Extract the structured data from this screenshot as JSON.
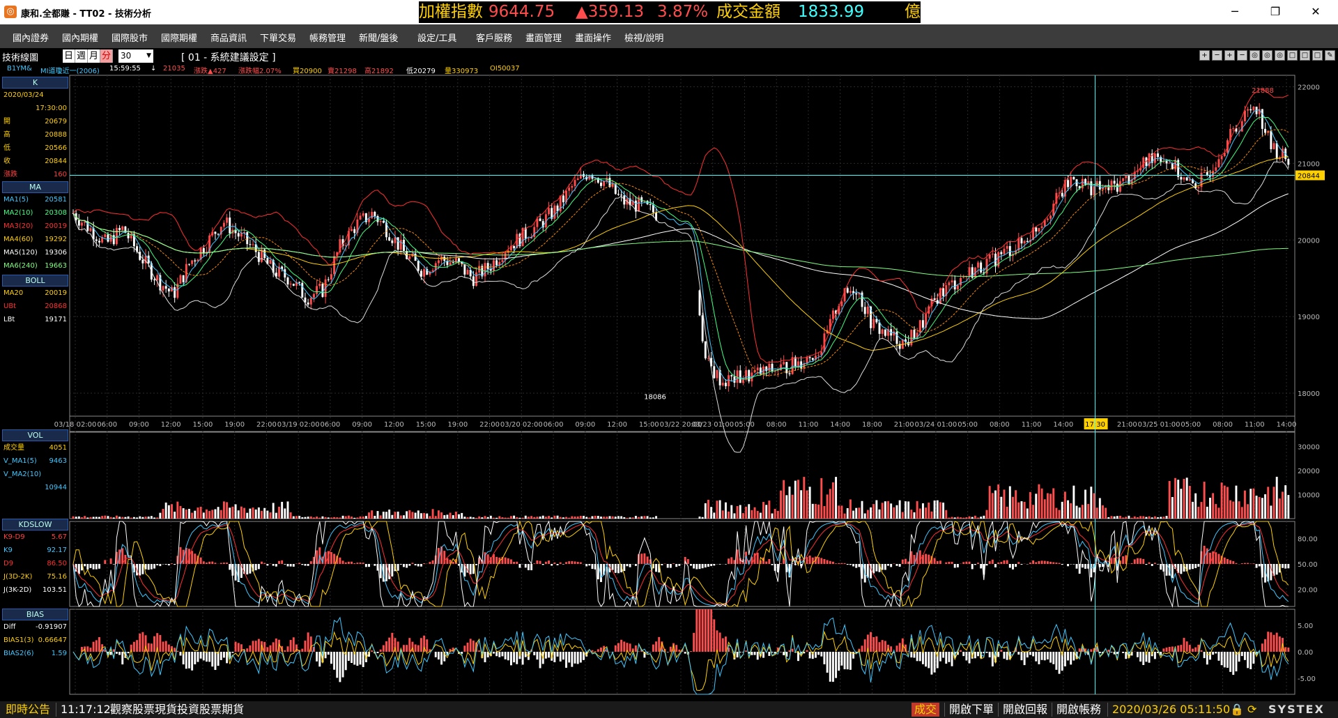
{
  "window": {
    "title": "康和.全都賺 - TT02 - 技術分析",
    "app_icon_text": "◎",
    "ticker": {
      "index_label": "加權指數",
      "index_value": "9644.75",
      "change": "▲359.13",
      "change_pct": "3.87%",
      "volume_label": "成交金額",
      "volume_value": "1833.99",
      "volume_unit": "億"
    },
    "controls": {
      "minimize": "─",
      "maximize": "❐",
      "close": "✕"
    }
  },
  "menu": [
    "國內證券",
    "國內期權",
    "國際股市",
    "國際期權",
    "商品資訊",
    "下單交易",
    "帳務管理",
    "新聞/盤後",
    "設定/工具",
    "客戶服務",
    "畫面管理",
    "畫面操作",
    "檢視/說明"
  ],
  "toolbar": {
    "label": "技術線圖",
    "periods": [
      "日",
      "週",
      "月",
      "分"
    ],
    "active_period": "分",
    "interval": "30",
    "system_setting": "[ 01 - 系統建議設定 ]",
    "icons": [
      "+",
      "─",
      "+",
      "─",
      "◎",
      "◎",
      "◎",
      "□",
      "□",
      "□",
      "✎"
    ]
  },
  "quote_strip": {
    "symbol": "B1YM&",
    "name": "MI道瓊近一(2006)",
    "time": "15:59:55",
    "arrow": "↓",
    "price": "21035",
    "change": "漲跌▲427",
    "change_pct": "漲跌幅2.07%",
    "buy": "買20900",
    "sell": "賣21298",
    "high": "高21892",
    "low": "低20279",
    "volume": "量330973",
    "oi": "OI50037"
  },
  "panels": {
    "k": {
      "header": "K",
      "date": "2020/03/24",
      "time": "17:30:00",
      "rows": [
        {
          "k": "開",
          "v": "20679",
          "color": "#ffd000"
        },
        {
          "k": "高",
          "v": "20888",
          "color": "#ffd000"
        },
        {
          "k": "低",
          "v": "20566",
          "color": "#ffd000"
        },
        {
          "k": "收",
          "v": "20844",
          "color": "#ffd000"
        },
        {
          "k": "漲跌",
          "v": "160",
          "color": "#ff4040"
        }
      ]
    },
    "ma": {
      "header": "MA",
      "rows": [
        {
          "k": "MA1(5)",
          "v": "20581",
          "color": "#40c8ff"
        },
        {
          "k": "MA2(10)",
          "v": "20308",
          "color": "#40ff80"
        },
        {
          "k": "MA3(20)",
          "v": "20019",
          "color": "#ff3030"
        },
        {
          "k": "MA4(60)",
          "v": "19292",
          "color": "#ffd000"
        },
        {
          "k": "MA5(120)",
          "v": "19306",
          "color": "#ffffff"
        },
        {
          "k": "MA6(240)",
          "v": "19663",
          "color": "#80ff80"
        }
      ]
    },
    "boll": {
      "header": "BOLL",
      "rows": [
        {
          "k": "MA20",
          "v": "20019",
          "color": "#ffd000"
        },
        {
          "k": "UBt",
          "v": "20868",
          "color": "#ff3030"
        },
        {
          "k": "LBt",
          "v": "19171",
          "color": "#ffffff"
        }
      ]
    },
    "vol": {
      "header": "VOL",
      "rows": [
        {
          "k": "成交量",
          "v": "4051",
          "color": "#ffd000"
        },
        {
          "k": "V_MA1(5)",
          "v": "9463",
          "color": "#40c8ff"
        },
        {
          "k": "V_MA2(10)",
          "v": "",
          "color": "#40c8ff"
        },
        {
          "k": "",
          "v": "10944",
          "color": "#40c8ff"
        }
      ]
    },
    "kd": {
      "header": "KDSLOW",
      "rows": [
        {
          "k": "K9-D9",
          "v": "5.67",
          "color": "#ff4040"
        },
        {
          "k": "K9",
          "v": "92.17",
          "color": "#40c8ff"
        },
        {
          "k": "D9",
          "v": "86.50",
          "color": "#ff3030"
        },
        {
          "k": "J(3D-2K)",
          "v": "75.16",
          "color": "#ffd000"
        },
        {
          "k": "J(3K-2D)",
          "v": "103.51",
          "color": "#ffffff"
        }
      ]
    },
    "bias": {
      "header": "BIAS",
      "rows": [
        {
          "k": "Diff",
          "v": "-0.91907",
          "color": "#ffffff"
        },
        {
          "k": "BIAS1(3)",
          "v": "0.66647",
          "color": "#ffd000"
        },
        {
          "k": "BIAS2(6)",
          "v": "1.59",
          "color": "#40c8ff"
        }
      ]
    }
  },
  "chart_data": {
    "type": "candlestick",
    "main_axis": {
      "ylim": [
        17700,
        22150
      ],
      "ticks": [
        "22000",
        "21000",
        "20000",
        "19000",
        "18000"
      ]
    },
    "current_price_label": "20844",
    "current_price": 20844,
    "high_marker": "21888",
    "high_value": 21888,
    "low_marker": "18086",
    "low_value": 18086,
    "cursor_label": "17:30",
    "x_labels": [
      "03/18 02:00",
      "06:00",
      "09:00",
      "12:00",
      "15:00",
      "19:00",
      "22:00",
      "03/19 02:00",
      "06:00",
      "09:00",
      "12:00",
      "15:00",
      "19:00",
      "22:00",
      "03/20 02:00",
      "06:00",
      "09:00",
      "12:00",
      "15:00",
      "03/22 20:00",
      "03/23 01:00",
      "05:00",
      "08:00",
      "11:00",
      "14:00",
      "18:00",
      "21:00",
      "03/24 01:00",
      "05:00",
      "08:00",
      "11:00",
      "14:00",
      "17:30",
      "21:00",
      "03/25 01:00",
      "05:00",
      "08:00",
      "11:00",
      "14:00"
    ],
    "close_path": [
      20350,
      20150,
      19950,
      20150,
      19800,
      19500,
      19280,
      19700,
      19950,
      20250,
      20050,
      19850,
      19600,
      19500,
      19250,
      19350,
      19900,
      20200,
      20350,
      20100,
      19800,
      19600,
      19750,
      19700,
      19500,
      19650,
      19900,
      20050,
      20200,
      20400,
      20700,
      20900,
      20750,
      20500,
      20450,
      20350,
      20250,
      20200,
      18400,
      18150,
      18200,
      18250,
      18300,
      18350,
      18450,
      18600,
      19200,
      19400,
      18900,
      18750,
      18650,
      18900,
      19300,
      19450,
      19600,
      19700,
      19850,
      19950,
      20200,
      20500,
      20800,
      20700,
      20650,
      20750,
      20900,
      21150,
      21000,
      20700,
      20800,
      21200,
      21500,
      21800,
      21200,
      21050
    ],
    "vol_axis": {
      "ticks": [
        "30000",
        "20000",
        "10000"
      ],
      "ylim": [
        0,
        36000
      ]
    },
    "kd_axis": {
      "ticks": [
        "80.00",
        "50.00",
        "20.00"
      ],
      "ylim": [
        0,
        100
      ]
    },
    "bias_axis": {
      "ticks": [
        "5.00",
        "0.00",
        "-5.00"
      ],
      "ylim": [
        -8,
        8
      ]
    },
    "colors": {
      "up": "#ff4d4d",
      "down": "#ffffff",
      "grid": "#2a2a2a",
      "axis": "#bbbbbb",
      "cursor": "#40ffff"
    }
  },
  "status": {
    "notice_label": "即時公告",
    "time": "11:17:12",
    "message": "觀察股票現貨投資股票期貨",
    "trade_tag": "成交",
    "buttons": [
      "開啟下單",
      "開啟回報",
      "開啟帳務"
    ],
    "datetime": "2020/03/26 05:11:50",
    "brand": "SYSTEX"
  }
}
